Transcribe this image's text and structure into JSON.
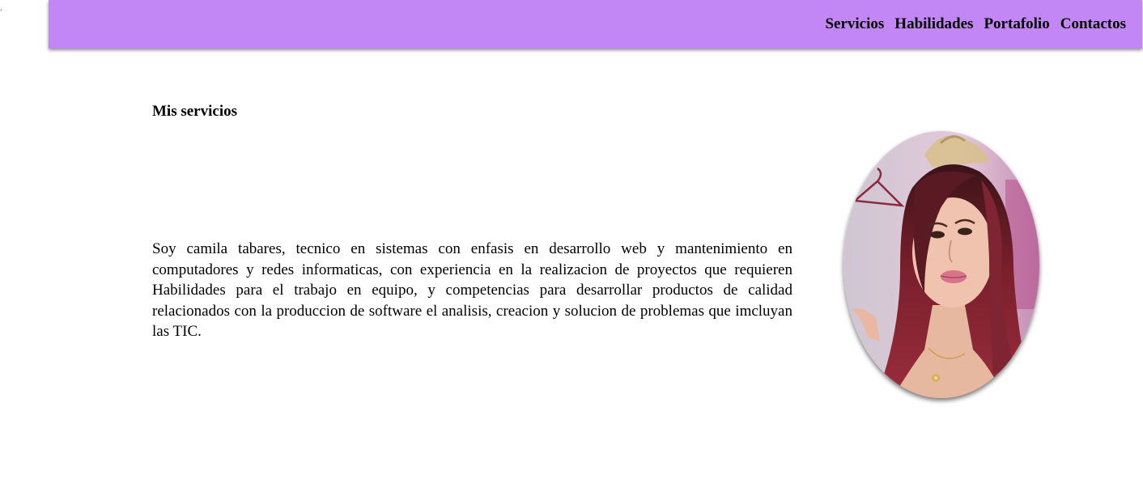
{
  "page": {
    "stray_mark": "."
  },
  "nav": {
    "background": "#c387f5",
    "items": [
      {
        "label": "Servicios"
      },
      {
        "label": "Habilidades"
      },
      {
        "label": "Portafolio"
      },
      {
        "label": "Contactos"
      }
    ]
  },
  "services": {
    "title": "Mis servicios",
    "description": "Soy camila tabares, tecnico en sistemas con enfasis en desarrollo web y mantenimiento en computadores y redes informaticas, con experiencia en la realizacion de proyectos que requieren Habilidades para el trabajo en equipo, y competencias para desarrollar productos de calidad relacionados con la produccion de software el analisis, creacion y solucion de problemas que imcluyan las TIC.",
    "photo_icon": "profile-photo"
  }
}
